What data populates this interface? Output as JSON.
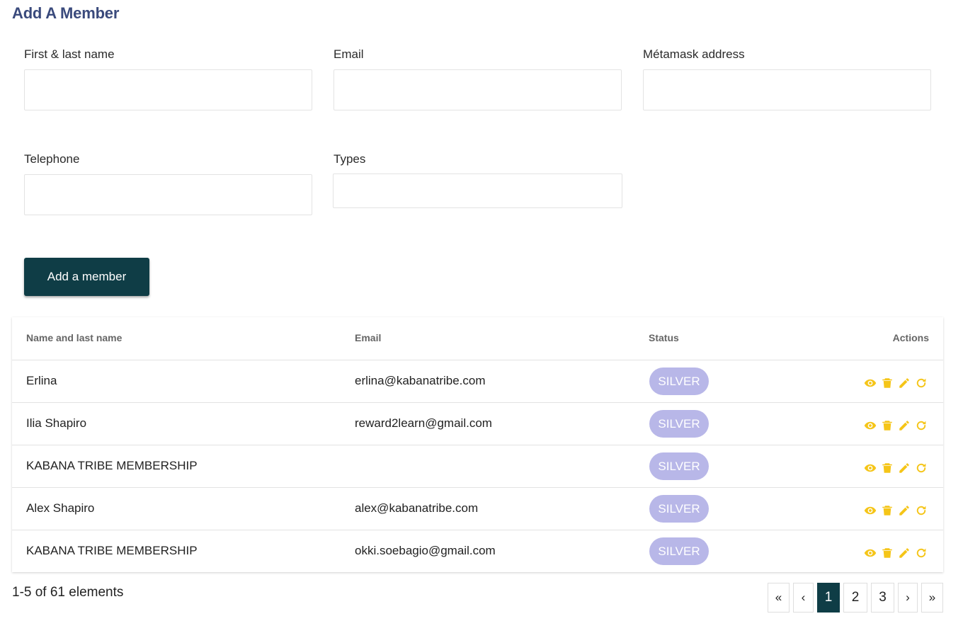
{
  "page": {
    "title": "Add A Member"
  },
  "form": {
    "name": {
      "label": "First & last name",
      "value": "",
      "placeholder": ""
    },
    "email": {
      "label": "Email",
      "value": "",
      "placeholder": ""
    },
    "metamask": {
      "label": "Métamask address",
      "value": "",
      "placeholder": ""
    },
    "telephone": {
      "label": "Telephone",
      "value": "",
      "placeholder": ""
    },
    "types": {
      "label": "Types",
      "value": ""
    },
    "submit_label": "Add a member"
  },
  "table": {
    "headers": {
      "name": "Name and last name",
      "email": "Email",
      "status": "Status",
      "actions": "Actions"
    },
    "rows": [
      {
        "name": "Erlina",
        "email": "erlina@kabanatribe.com",
        "status": "SILVER"
      },
      {
        "name": "Ilia Shapiro",
        "email": "reward2learn@gmail.com",
        "status": "SILVER"
      },
      {
        "name": "KABANA TRIBE MEMBERSHIP",
        "email": "",
        "status": "SILVER"
      },
      {
        "name": "Alex Shapiro",
        "email": "alex@kabanatribe.com",
        "status": "SILVER"
      },
      {
        "name": "KABANA TRIBE MEMBERSHIP",
        "email": "okki.soebagio@gmail.com",
        "status": "SILVER"
      }
    ],
    "row_action_icons": [
      "eye-icon",
      "trash-icon",
      "pencil-icon",
      "refresh-icon"
    ]
  },
  "pagination": {
    "summary": "1-5 of 61 elements",
    "first": "«",
    "prev": "‹",
    "pages": [
      "1",
      "2",
      "3"
    ],
    "current_page": "1",
    "next": "›",
    "last": "»"
  },
  "colors": {
    "title": "#3a4a7c",
    "primary": "#0f3d46",
    "badge": "#b8b7e8",
    "action_icon": "#f5c518"
  }
}
